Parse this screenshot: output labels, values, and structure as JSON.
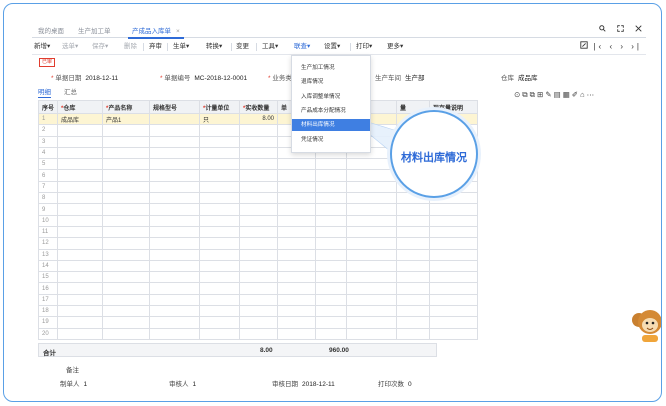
{
  "tabs": [
    {
      "label": "我的桌面",
      "active": false
    },
    {
      "label": "生产加工单",
      "active": false
    },
    {
      "label": "产成品入库单",
      "active": true
    }
  ],
  "tab_close_glyph": "×",
  "window_icons": [
    "search-icon",
    "restore-icon",
    "close-icon"
  ],
  "toolbar": {
    "new": "新增",
    "pick": "选单",
    "save": "保存",
    "delete": "删除",
    "unaudit": "弃审",
    "generate": "生单",
    "convert": "转换",
    "change": "变更",
    "tools": "工具",
    "link": "联查",
    "settings": "设置",
    "print": "打印",
    "more": "更多",
    "dropdown_glyph": "▾"
  },
  "nav_icons": [
    "template-icon",
    "first-icon",
    "prev-icon",
    "next-icon",
    "last-icon"
  ],
  "stamp": "已审",
  "header_fields": {
    "doc_date_label": "单据日期",
    "doc_date": "2018-12-11",
    "doc_no_label": "单据编号",
    "doc_no": "MC-2018-12-0001",
    "biz_label": "业务类",
    "workshop_label": "生产车间",
    "workshop": "生产部",
    "warehouse_label": "仓库",
    "warehouse": "成品库"
  },
  "subtabs": [
    "明细",
    "汇总"
  ],
  "table": {
    "columns": [
      "序号",
      "仓库",
      "产品名称",
      "规格型号",
      "计量单位",
      "实收数量",
      "单",
      "",
      "",
      "量",
      "现存量说明"
    ],
    "required_columns": [
      1,
      2,
      4,
      5
    ],
    "rows": [
      [
        "1",
        "成品库",
        "产品1",
        "",
        "只",
        "8.00",
        "",
        "",
        "",
        "",
        ""
      ],
      [
        "2",
        "",
        "",
        "",
        "",
        "",
        "",
        "",
        "",
        "",
        ""
      ],
      [
        "3",
        "",
        "",
        "",
        "",
        "",
        "",
        "",
        "",
        "",
        ""
      ],
      [
        "4",
        "",
        "",
        "",
        "",
        "",
        "",
        "",
        "",
        "",
        ""
      ],
      [
        "5",
        "",
        "",
        "",
        "",
        "",
        "",
        "",
        "",
        "",
        ""
      ],
      [
        "6",
        "",
        "",
        "",
        "",
        "",
        "",
        "",
        "",
        "",
        ""
      ],
      [
        "7",
        "",
        "",
        "",
        "",
        "",
        "",
        "",
        "",
        "",
        ""
      ],
      [
        "8",
        "",
        "",
        "",
        "",
        "",
        "",
        "",
        "",
        "",
        ""
      ],
      [
        "9",
        "",
        "",
        "",
        "",
        "",
        "",
        "",
        "",
        "",
        ""
      ],
      [
        "10",
        "",
        "",
        "",
        "",
        "",
        "",
        "",
        "",
        "",
        ""
      ],
      [
        "11",
        "",
        "",
        "",
        "",
        "",
        "",
        "",
        "",
        "",
        ""
      ],
      [
        "12",
        "",
        "",
        "",
        "",
        "",
        "",
        "",
        "",
        "",
        ""
      ],
      [
        "13",
        "",
        "",
        "",
        "",
        "",
        "",
        "",
        "",
        "",
        ""
      ],
      [
        "14",
        "",
        "",
        "",
        "",
        "",
        "",
        "",
        "",
        "",
        ""
      ],
      [
        "15",
        "",
        "",
        "",
        "",
        "",
        "",
        "",
        "",
        "",
        ""
      ],
      [
        "16",
        "",
        "",
        "",
        "",
        "",
        "",
        "",
        "",
        "",
        ""
      ],
      [
        "17",
        "",
        "",
        "",
        "",
        "",
        "",
        "",
        "",
        "",
        ""
      ],
      [
        "18",
        "",
        "",
        "",
        "",
        "",
        "",
        "",
        "",
        "",
        ""
      ],
      [
        "19",
        "",
        "",
        "",
        "",
        "",
        "",
        "",
        "",
        "",
        ""
      ],
      [
        "20",
        "",
        "",
        "",
        "",
        "",
        "",
        "",
        "",
        "",
        ""
      ]
    ]
  },
  "totals": {
    "label": "合计",
    "qty": "8.00",
    "amount": "960.00"
  },
  "footer": {
    "remark_label": "备注",
    "maker_label": "制单人",
    "maker": "1",
    "auditor_label": "审核人",
    "auditor": "1",
    "audit_date_label": "审核日期",
    "audit_date": "2018-12-11",
    "print_count_label": "打印次数",
    "print_count": "0"
  },
  "link_menu": {
    "items": [
      "生产加工情况",
      "退库情况",
      "入库调整单情况",
      "产品成本分配情况",
      "材料出库情况",
      "凭证情况"
    ],
    "selected_index": 4
  },
  "callout": "材料出库情况",
  "colors": {
    "accent": "#2f6bd7",
    "required": "#e03c2e",
    "selected_row": "#fdf5d3",
    "menu_selected": "#3f7fe2",
    "frame": "#5aa0e6"
  }
}
